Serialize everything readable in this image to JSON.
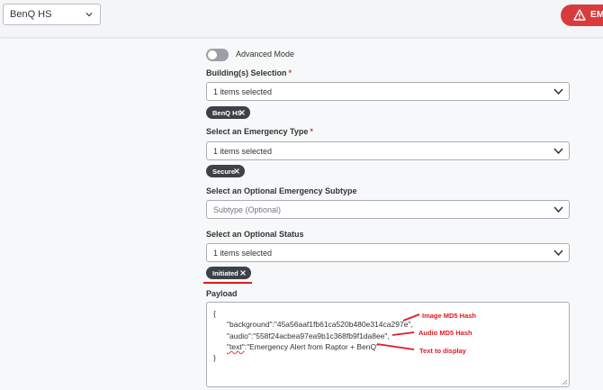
{
  "header": {
    "site_select_value": "BenQ HS",
    "emergency_button_label": "EMI"
  },
  "form": {
    "advanced_mode_label": "Advanced Mode",
    "advanced_mode_on": false,
    "buildings": {
      "label": "Building(s) Selection",
      "required_mark": "*",
      "value": "1 items selected",
      "chips": [
        "BenQ HS"
      ]
    },
    "emergency_type": {
      "label": "Select an Emergency Type",
      "required_mark": "*",
      "value": "1 items selected",
      "chips": [
        "Secure"
      ]
    },
    "subtype": {
      "label": "Select an Optional Emergency Subtype",
      "placeholder": "Subtype (Optional)"
    },
    "status": {
      "label": "Select an Optional Status",
      "value": "1 items selected",
      "chips": [
        "Initiated"
      ]
    },
    "payload": {
      "label": "Payload",
      "lines": [
        "{",
        "\"background\":\"45a56aaf1fb61ca520b480e314ca297e\",",
        "\"audio\":\"558f24acbea97ea9b1c368fb9f1da8ee\",",
        "\"text\":\"Emergency Alert from Raptor + BenQ\"",
        "}"
      ],
      "text_line_key": "\"text\"",
      "text_line_value": ":\"Emergency Alert from Raptor + BenQ\""
    }
  },
  "annotations": {
    "image_hash": "Image MD5 Hash",
    "audio_hash": "Audio MD5 Hash",
    "text_display": "Text to display",
    "color": "#e0191f"
  },
  "icons": {
    "site_chevron": "chevron-down-icon",
    "warning": "warning-triangle-icon",
    "chip_remove": "close-icon",
    "dropdown_chevron": "chevron-down-icon",
    "resize": "resize-grip-icon"
  }
}
